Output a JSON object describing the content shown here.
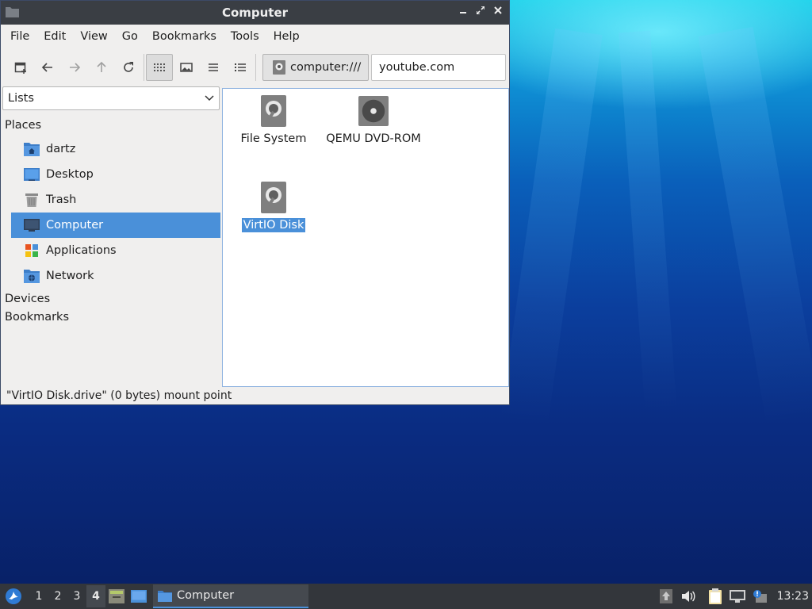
{
  "window": {
    "title": "Computer"
  },
  "menubar": [
    "File",
    "Edit",
    "View",
    "Go",
    "Bookmarks",
    "Tools",
    "Help"
  ],
  "location": {
    "path_button": "computer:///",
    "field_value": "youtube.com"
  },
  "sidebar": {
    "dropdown": "Lists",
    "places_header": "Places",
    "items": [
      {
        "label": "dartz",
        "icon": "home-folder-icon"
      },
      {
        "label": "Desktop",
        "icon": "desktop-icon"
      },
      {
        "label": "Trash",
        "icon": "trash-icon"
      },
      {
        "label": "Computer",
        "icon": "computer-icon",
        "selected": true
      },
      {
        "label": "Applications",
        "icon": "applications-icon"
      },
      {
        "label": "Network",
        "icon": "network-icon"
      }
    ],
    "devices_header": "Devices",
    "bookmarks_header": "Bookmarks"
  },
  "files": [
    {
      "label": "File System",
      "icon": "harddisk-icon"
    },
    {
      "label": "QEMU DVD-ROM",
      "icon": "optical-drive-icon"
    },
    {
      "label": "VirtIO Disk",
      "icon": "harddisk-icon",
      "selected": true
    }
  ],
  "statusbar": "\"VirtIO Disk.drive\" (0 bytes) mount point",
  "taskbar": {
    "workspaces": [
      "1",
      "2",
      "3",
      "4"
    ],
    "active_workspace": "4",
    "task_label": "Computer",
    "clock": "13:23"
  },
  "colors": {
    "selection": "#4a90d9",
    "titlebar": "#3a3e44",
    "taskbar": "#33363b"
  }
}
